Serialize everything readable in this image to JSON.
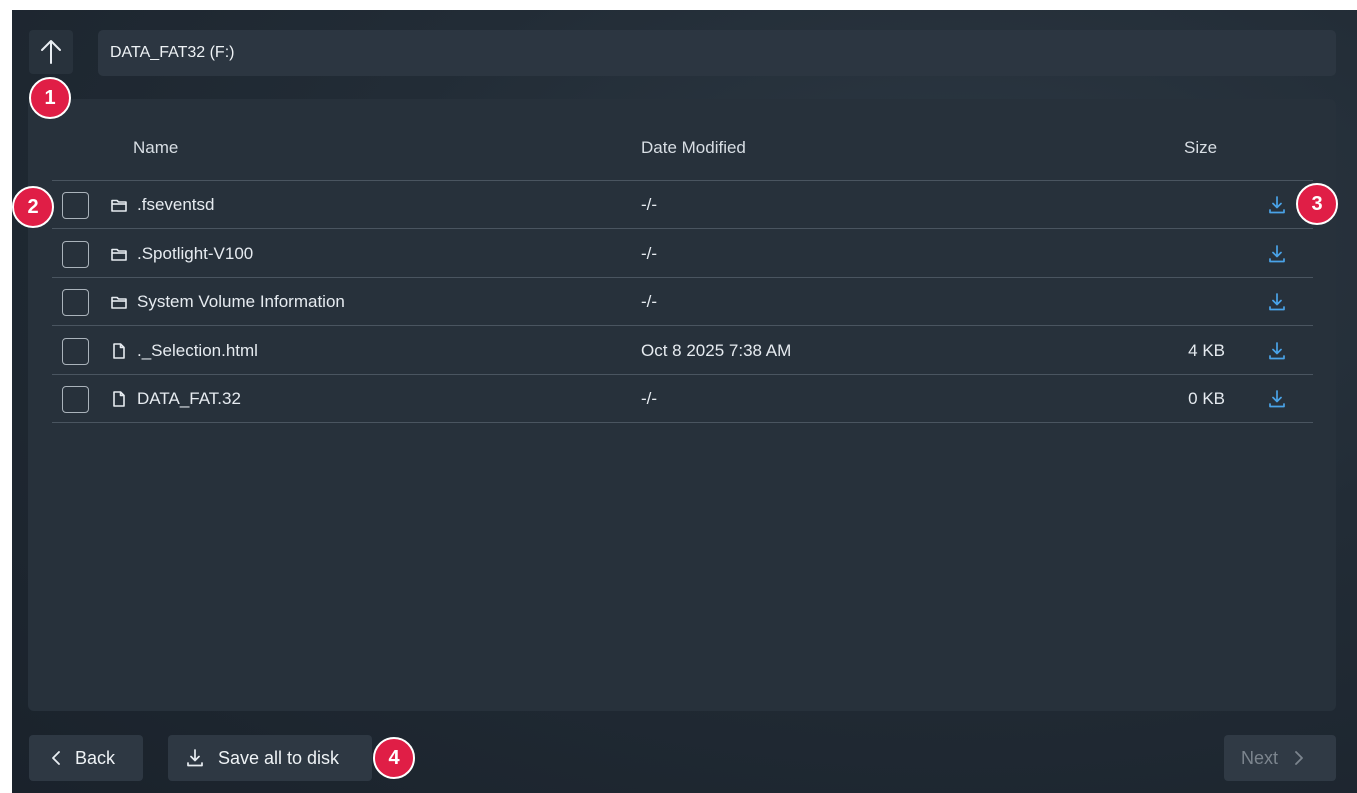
{
  "path_bar": {
    "value": "DATA_FAT32 (F:)"
  },
  "table": {
    "columns": [
      "Name",
      "Date Modified",
      "Size"
    ],
    "rows": [
      {
        "type": "folder",
        "name": ".fseventsd",
        "date": "-/-",
        "size": ""
      },
      {
        "type": "folder",
        "name": ".Spotlight-V100",
        "date": "-/-",
        "size": ""
      },
      {
        "type": "folder",
        "name": "System Volume Information",
        "date": "-/-",
        "size": ""
      },
      {
        "type": "file",
        "name": "._Selection.html",
        "date": "Oct 8  2025  7:38 AM",
        "size": "4 KB"
      },
      {
        "type": "file",
        "name": "DATA_FAT.32",
        "date": "-/-",
        "size": "0 KB"
      }
    ]
  },
  "buttons": {
    "back": "Back",
    "save_all": "Save all to disk",
    "next": "Next"
  },
  "badges": [
    "1",
    "2",
    "3",
    "4"
  ],
  "icons": {
    "up": "arrow-up-icon",
    "folder": "folder-icon",
    "file": "file-icon",
    "download": "download-icon",
    "back": "chevron-left-icon",
    "next": "chevron-right-icon"
  },
  "colors": {
    "background": "#222c36",
    "panel": "#27313b",
    "accent_blue": "#4aa3e8",
    "badge_red": "#e01e46"
  }
}
